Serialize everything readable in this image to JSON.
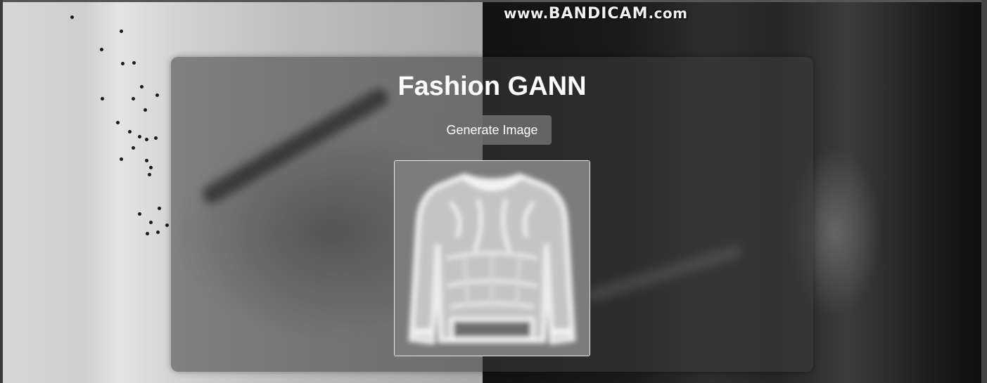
{
  "watermark": {
    "prefix": "www.",
    "brand": "BANDICAM",
    "suffix": ".com"
  },
  "app": {
    "title": "Fashion GANN",
    "generate_button_label": "Generate Image"
  },
  "generated_image": {
    "subject": "sweater-icon"
  },
  "colors": {
    "card_background": "#3c3c3c",
    "button_background": "#6e6e6e",
    "title_text": "#ffffff",
    "image_background": "#7c7c7c"
  }
}
